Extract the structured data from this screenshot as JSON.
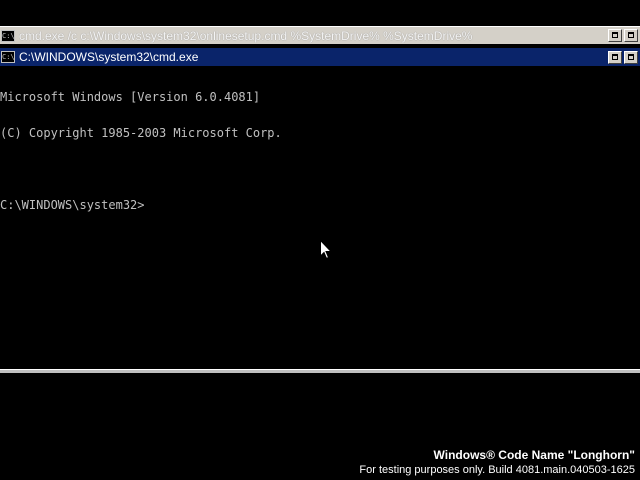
{
  "background_window": {
    "title": "cmd.exe /c c:\\Windows\\system32\\onlinesetup.cmd %SystemDrive% %SystemDrive%",
    "icon_label": "C:\\"
  },
  "active_window": {
    "title": "C:\\WINDOWS\\system32\\cmd.exe",
    "icon_label": "C:\\"
  },
  "console": {
    "lines": [
      "Microsoft Windows [Version 6.0.4081]",
      "(C) Copyright 1985-2003 Microsoft Corp.",
      "",
      "C:\\WINDOWS\\system32>"
    ]
  },
  "watermark": {
    "line1": "Windows® Code Name \"Longhorn\"",
    "line2": "For testing purposes only. Build 4081.main.040503-1625"
  },
  "colors": {
    "active_title": "#0a246a",
    "inactive_title": "#d4d0c8",
    "console_text": "#c0c0c0",
    "background": "#000000"
  }
}
